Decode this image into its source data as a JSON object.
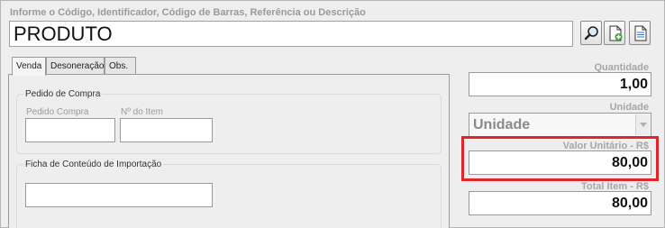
{
  "search": {
    "label": "Informe o Código, Identificador, Código de Barras, Referência ou Descrição",
    "value": "PRODUTO"
  },
  "toolbar": {
    "search_icon": "magnifier-icon",
    "add_icon": "add-document-icon",
    "doc_icon": "document-icon"
  },
  "tabs": [
    {
      "label": "Venda"
    },
    {
      "label": "Desoneração"
    },
    {
      "label": "Obs."
    }
  ],
  "pedido_compra": {
    "title": "Pedido de Compra",
    "pedido_label": "Pedido Compra",
    "item_label": "Nº do Item"
  },
  "ficha": {
    "title": "Ficha de Conteúdo de Importação"
  },
  "right": {
    "quantidade_label": "Quantidade",
    "quantidade_value": "1,00",
    "unidade_label": "Unidade",
    "unidade_value": "Unidade",
    "valor_label": "Valor Unitário - R$",
    "valor_value": "80,00",
    "total_label": "Total Item - R$",
    "total_value": "80,00"
  },
  "colors": {
    "highlight": "#e0262d"
  }
}
